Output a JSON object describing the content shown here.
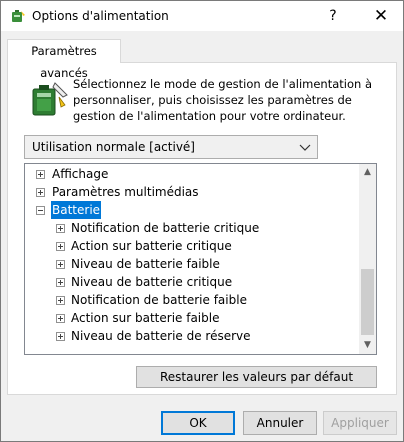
{
  "window": {
    "title": "Options d'alimentation",
    "help_glyph": "?",
    "close_glyph": "✕"
  },
  "tab": {
    "label": "Paramètres avancés"
  },
  "description": "Sélectionnez le mode de gestion de l'alimentation à personnaliser, puis choisissez les paramètres de gestion de l'alimentation pour votre ordinateur.",
  "plan_select": {
    "value": "Utilisation normale [activé]"
  },
  "tree": {
    "items": [
      {
        "label": "Affichage",
        "state": "collapsed",
        "selected": false
      },
      {
        "label": "Paramètres multimédias",
        "state": "collapsed",
        "selected": false
      },
      {
        "label": "Batterie",
        "state": "expanded",
        "selected": true
      },
      {
        "label": "Notification de batterie critique",
        "state": "collapsed",
        "selected": false
      },
      {
        "label": "Action sur batterie critique",
        "state": "collapsed",
        "selected": false
      },
      {
        "label": "Niveau de batterie faible",
        "state": "collapsed",
        "selected": false
      },
      {
        "label": "Niveau de batterie critique",
        "state": "collapsed",
        "selected": false
      },
      {
        "label": "Notification de batterie faible",
        "state": "collapsed",
        "selected": false
      },
      {
        "label": "Action sur batterie faible",
        "state": "collapsed",
        "selected": false
      },
      {
        "label": "Niveau de batterie de réserve",
        "state": "collapsed",
        "selected": false
      }
    ]
  },
  "buttons": {
    "restore": "Restaurer les valeurs par défaut",
    "ok": "OK",
    "cancel": "Annuler",
    "apply": "Appliquer"
  },
  "icons": {
    "app": "power-options-icon",
    "battery": "battery-settings-icon"
  },
  "colors": {
    "selection": "#0078d7",
    "default_button_border": "#0078d7"
  }
}
